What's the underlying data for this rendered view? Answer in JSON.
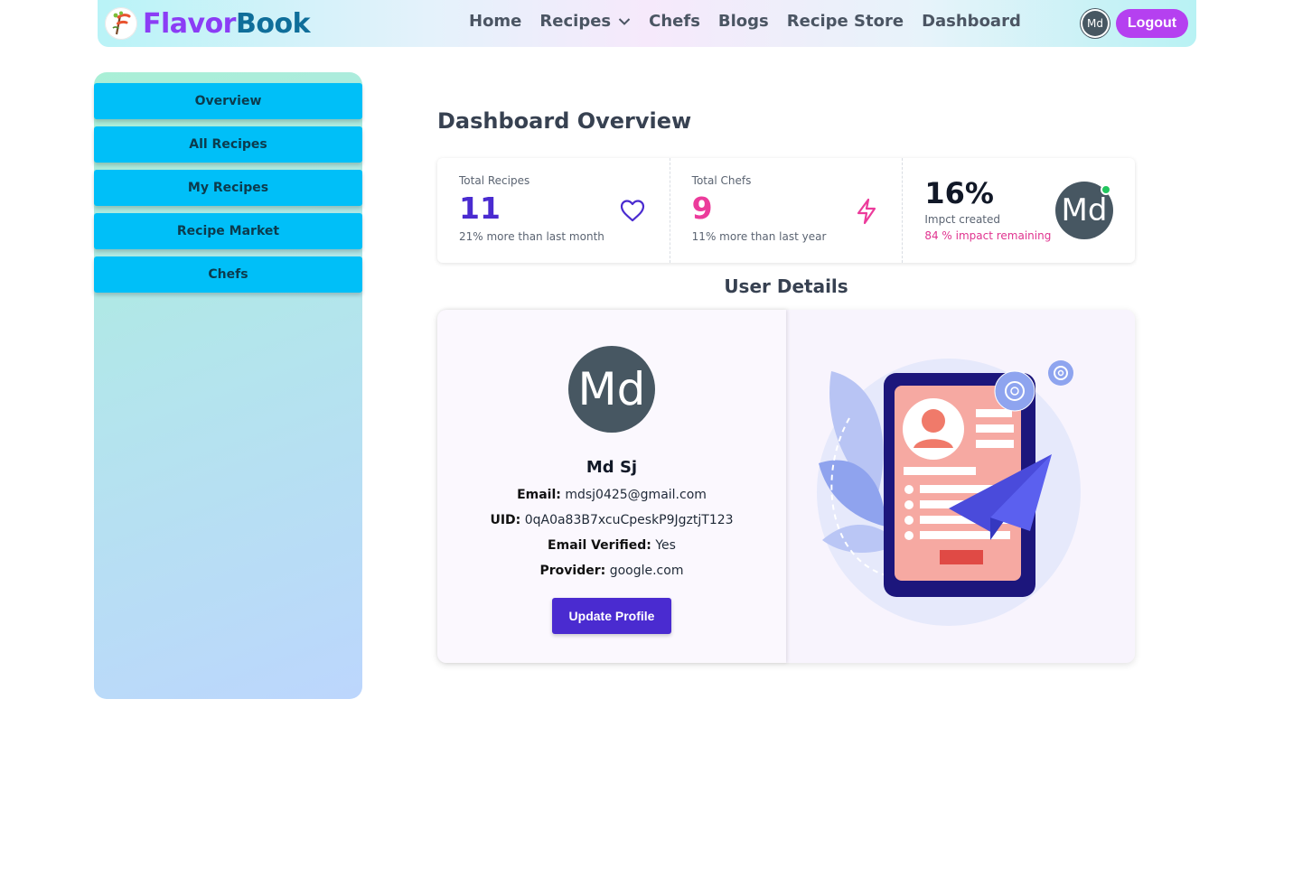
{
  "navbar": {
    "brand_part1": "Flavor",
    "brand_part2": "Book",
    "links": [
      "Home",
      "Recipes",
      "Chefs",
      "Blogs",
      "Recipe Store",
      "Dashboard"
    ],
    "avatar_initials": "Md",
    "logout_label": "Logout"
  },
  "sidebar": {
    "items": [
      "Overview",
      "All Recipes",
      "My Recipes",
      "Recipe Market",
      "Chefs"
    ]
  },
  "main": {
    "title": "Dashboard Overview",
    "stats": [
      {
        "label": "Total Recipes",
        "value": "11",
        "desc": "21% more than last month",
        "icon": "heart-icon"
      },
      {
        "label": "Total Chefs",
        "value": "9",
        "desc": "11% more than last year",
        "icon": "lightning-icon"
      },
      {
        "value": "16%",
        "label": "Impct created",
        "desc": "84 % impact remaining",
        "avatar_initials": "Md"
      }
    ],
    "user_section_title": "User Details",
    "user": {
      "avatar_initials": "Md",
      "name": "Md Sj",
      "email_label": "Email:",
      "email": "mdsj0425@gmail.com",
      "uid_label": "UID:",
      "uid": "0qA0a83B7xcuCpeskP9JgztjT123",
      "verified_label": "Email Verified:",
      "verified": "Yes",
      "provider_label": "Provider:",
      "provider": "google.com",
      "update_button": "Update Profile"
    }
  },
  "colors": {
    "accent_purple": "#4a2bd0",
    "accent_pink": "#ec3b9b",
    "sidebar_button": "#00bff8",
    "logout": "#b540f0"
  }
}
